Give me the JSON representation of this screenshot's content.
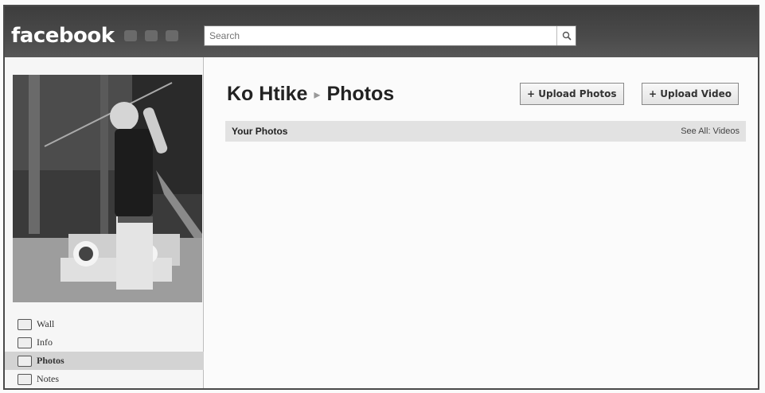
{
  "header": {
    "logo": "facebook",
    "search_placeholder": "Search"
  },
  "profile": {
    "name": "Ko Htike",
    "page": "Photos"
  },
  "nav": {
    "items": [
      {
        "label": "Wall",
        "icon": "wall-icon"
      },
      {
        "label": "Info",
        "icon": "info-icon"
      },
      {
        "label": "Photos",
        "icon": "photos-icon",
        "active": true
      },
      {
        "label": "Notes",
        "icon": "notes-icon"
      }
    ]
  },
  "actions": {
    "upload_photos": "+ Upload Photos",
    "upload_video": "+ Upload Video"
  },
  "section": {
    "title": "Your Photos",
    "link": "See All: Videos"
  }
}
